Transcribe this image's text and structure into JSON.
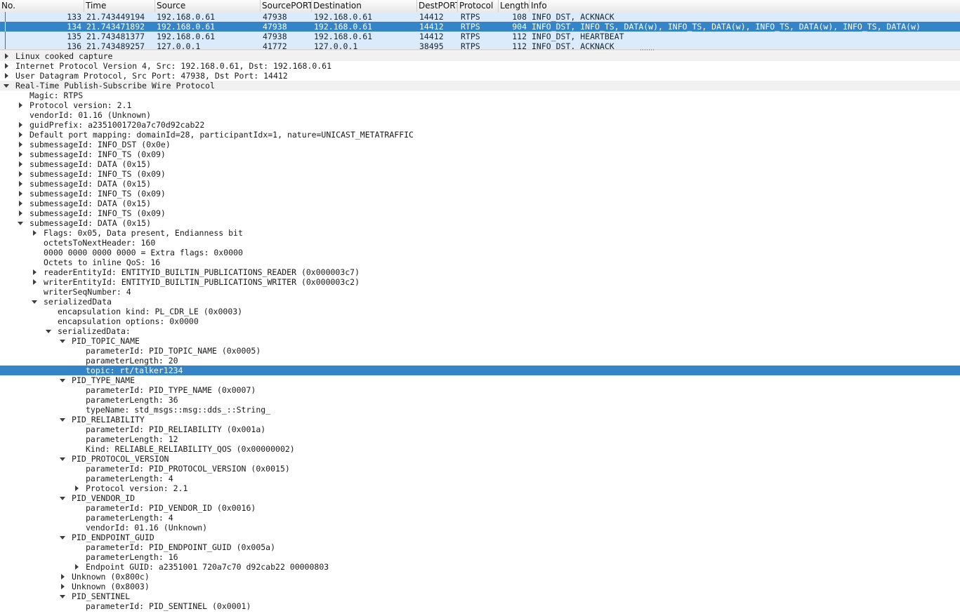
{
  "columns": [
    {
      "label": "No."
    },
    {
      "label": "Time"
    },
    {
      "label": "Source"
    },
    {
      "label": "SourcePORT"
    },
    {
      "label": "Destination"
    },
    {
      "label": "DestPORT"
    },
    {
      "label": "Protocol"
    },
    {
      "label": "Length"
    },
    {
      "label": "Info"
    }
  ],
  "packets": [
    {
      "no": "133",
      "time": "21.743449194",
      "src": "192.168.0.61",
      "sport": "47938",
      "dst": "192.168.0.61",
      "dport": "14412",
      "proto": "RTPS",
      "len": "108",
      "info": "INFO_DST, ACKNACK",
      "selected": false
    },
    {
      "no": "134",
      "time": "21.743471892",
      "src": "192.168.0.61",
      "sport": "47938",
      "dst": "192.168.0.61",
      "dport": "14412",
      "proto": "RTPS",
      "len": "904",
      "info": "INFO_DST, INFO_TS, DATA(w), INFO_TS, DATA(w), INFO_TS, DATA(w), INFO_TS, DATA(w)",
      "selected": true
    },
    {
      "no": "135",
      "time": "21.743481377",
      "src": "192.168.0.61",
      "sport": "47938",
      "dst": "192.168.0.61",
      "dport": "14412",
      "proto": "RTPS",
      "len": "112",
      "info": "INFO_DST, HEARTBEAT",
      "selected": false
    },
    {
      "no": "136",
      "time": "21.743489257",
      "src": "127.0.0.1",
      "sport": "41772",
      "dst": "127.0.0.1",
      "dport": "38495",
      "proto": "RTPS",
      "len": "112",
      "info": "INFO_DST, ACKNACK",
      "selected": false
    }
  ],
  "tree": [
    {
      "text": "Linux cooked capture",
      "depth": 0,
      "state": "collapsed",
      "highlight": true
    },
    {
      "text": "Internet Protocol Version 4, Src: 192.168.0.61, Dst: 192.168.0.61",
      "depth": 0,
      "state": "collapsed"
    },
    {
      "text": "User Datagram Protocol, Src Port: 47938, Dst Port: 14412",
      "depth": 0,
      "state": "collapsed"
    },
    {
      "text": "Real-Time Publish-Subscribe Wire Protocol",
      "depth": 0,
      "state": "expanded",
      "highlight": true
    },
    {
      "text": "Magic: RTPS",
      "depth": 1,
      "state": "none"
    },
    {
      "text": "Protocol version: 2.1",
      "depth": 1,
      "state": "collapsed"
    },
    {
      "text": "vendorId: 01.16 (Unknown)",
      "depth": 1,
      "state": "none"
    },
    {
      "text": "guidPrefix: a2351001720a7c70d92cab22",
      "depth": 1,
      "state": "collapsed"
    },
    {
      "text": "Default port mapping: domainId=28, participantIdx=1, nature=UNICAST_METATRAFFIC",
      "depth": 1,
      "state": "collapsed"
    },
    {
      "text": "submessageId: INFO_DST (0x0e)",
      "depth": 1,
      "state": "collapsed"
    },
    {
      "text": "submessageId: INFO_TS (0x09)",
      "depth": 1,
      "state": "collapsed"
    },
    {
      "text": "submessageId: DATA (0x15)",
      "depth": 1,
      "state": "collapsed"
    },
    {
      "text": "submessageId: INFO_TS (0x09)",
      "depth": 1,
      "state": "collapsed"
    },
    {
      "text": "submessageId: DATA (0x15)",
      "depth": 1,
      "state": "collapsed"
    },
    {
      "text": "submessageId: INFO_TS (0x09)",
      "depth": 1,
      "state": "collapsed"
    },
    {
      "text": "submessageId: DATA (0x15)",
      "depth": 1,
      "state": "collapsed"
    },
    {
      "text": "submessageId: INFO_TS (0x09)",
      "depth": 1,
      "state": "collapsed"
    },
    {
      "text": "submessageId: DATA (0x15)",
      "depth": 1,
      "state": "expanded"
    },
    {
      "text": "Flags: 0x05, Data present, Endianness bit",
      "depth": 2,
      "state": "collapsed"
    },
    {
      "text": "octetsToNextHeader: 160",
      "depth": 2,
      "state": "none"
    },
    {
      "text": "0000 0000 0000 0000 = Extra flags: 0x0000",
      "depth": 2,
      "state": "none"
    },
    {
      "text": "Octets to inline QoS: 16",
      "depth": 2,
      "state": "none"
    },
    {
      "text": "readerEntityId: ENTITYID_BUILTIN_PUBLICATIONS_READER (0x000003c7)",
      "depth": 2,
      "state": "collapsed"
    },
    {
      "text": "writerEntityId: ENTITYID_BUILTIN_PUBLICATIONS_WRITER (0x000003c2)",
      "depth": 2,
      "state": "collapsed"
    },
    {
      "text": "writerSeqNumber: 4",
      "depth": 2,
      "state": "none"
    },
    {
      "text": "serializedData",
      "depth": 2,
      "state": "expanded"
    },
    {
      "text": "encapsulation kind: PL_CDR_LE (0x0003)",
      "depth": 3,
      "state": "none"
    },
    {
      "text": "encapsulation options: 0x0000",
      "depth": 3,
      "state": "none"
    },
    {
      "text": "serializedData:",
      "depth": 3,
      "state": "expanded"
    },
    {
      "text": "PID_TOPIC_NAME",
      "depth": 4,
      "state": "expanded"
    },
    {
      "text": "parameterId: PID_TOPIC_NAME (0x0005)",
      "depth": 5,
      "state": "none"
    },
    {
      "text": "parameterLength: 20",
      "depth": 5,
      "state": "none"
    },
    {
      "text": "topic: rt/talker1234",
      "depth": 5,
      "state": "none",
      "selected": true
    },
    {
      "text": "PID_TYPE_NAME",
      "depth": 4,
      "state": "expanded"
    },
    {
      "text": "parameterId: PID_TYPE_NAME (0x0007)",
      "depth": 5,
      "state": "none"
    },
    {
      "text": "parameterLength: 36",
      "depth": 5,
      "state": "none"
    },
    {
      "text": "typeName: std_msgs::msg::dds_::String_",
      "depth": 5,
      "state": "none"
    },
    {
      "text": "PID_RELIABILITY",
      "depth": 4,
      "state": "expanded"
    },
    {
      "text": "parameterId: PID_RELIABILITY (0x001a)",
      "depth": 5,
      "state": "none"
    },
    {
      "text": "parameterLength: 12",
      "depth": 5,
      "state": "none"
    },
    {
      "text": "Kind: RELIABLE_RELIABILITY_QOS (0x00000002)",
      "depth": 5,
      "state": "none"
    },
    {
      "text": "PID_PROTOCOL_VERSION",
      "depth": 4,
      "state": "expanded"
    },
    {
      "text": "parameterId: PID_PROTOCOL_VERSION (0x0015)",
      "depth": 5,
      "state": "none"
    },
    {
      "text": "parameterLength: 4",
      "depth": 5,
      "state": "none"
    },
    {
      "text": "Protocol version: 2.1",
      "depth": 5,
      "state": "collapsed"
    },
    {
      "text": "PID_VENDOR_ID",
      "depth": 4,
      "state": "expanded"
    },
    {
      "text": "parameterId: PID_VENDOR_ID (0x0016)",
      "depth": 5,
      "state": "none"
    },
    {
      "text": "parameterLength: 4",
      "depth": 5,
      "state": "none"
    },
    {
      "text": "vendorId: 01.16 (Unknown)",
      "depth": 5,
      "state": "none"
    },
    {
      "text": "PID_ENDPOINT_GUID",
      "depth": 4,
      "state": "expanded"
    },
    {
      "text": "parameterId: PID_ENDPOINT_GUID (0x005a)",
      "depth": 5,
      "state": "none"
    },
    {
      "text": "parameterLength: 16",
      "depth": 5,
      "state": "none"
    },
    {
      "text": "Endpoint GUID: a2351001 720a7c70 d92cab22 00000803",
      "depth": 5,
      "state": "collapsed"
    },
    {
      "text": "Unknown (0x800c)",
      "depth": 4,
      "state": "collapsed"
    },
    {
      "text": "Unknown (0x8003)",
      "depth": 4,
      "state": "collapsed"
    },
    {
      "text": "PID_SENTINEL",
      "depth": 4,
      "state": "expanded"
    },
    {
      "text": "parameterId: PID_SENTINEL (0x0001)",
      "depth": 5,
      "state": "none"
    }
  ]
}
